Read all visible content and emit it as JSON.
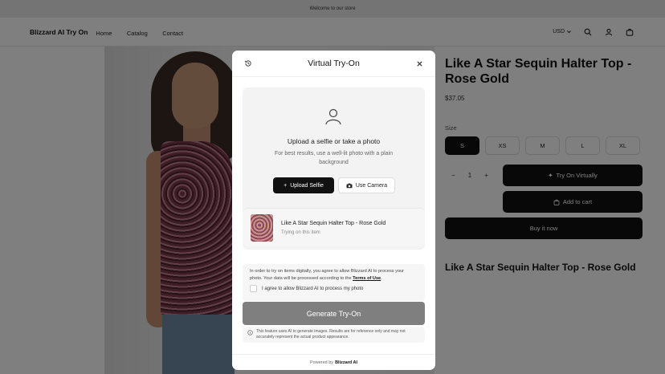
{
  "announcement": "Welcome to our store",
  "header": {
    "brand": "Blizzard AI Try On",
    "nav": [
      "Home",
      "Catalog",
      "Contact"
    ],
    "currency": "USD"
  },
  "product": {
    "title": "Like A Star Sequin Halter Top - Rose Gold",
    "price": "$37.05",
    "size_label": "Size",
    "sizes": [
      "S",
      "XS",
      "M",
      "L",
      "XL"
    ],
    "selected_size": "S",
    "quantity": "1",
    "try_on_label": "Try On Virtually",
    "add_to_cart_label": "Add to cart",
    "buy_now_label": "Buy it now"
  },
  "modal": {
    "title": "Virtual Try-On",
    "upload_title": "Upload a selfie or take a photo",
    "upload_sub": "For best results, use a well-lit photo with a plain background",
    "upload_button": "Upload Selfie",
    "camera_button": "Use Camera",
    "product_title": "Like A Star Sequin Halter Top - Rose Gold",
    "product_sub": "Trying on this item",
    "consent_text": "In order to try on items digitally, you agree to allow Blizzard AI to process your photo. Your data will be processed according to the",
    "terms_link": "Terms of Use",
    "consent_period": ".",
    "checkbox_label": "I agree to allow Blizzard AI to process my photo",
    "generate_button": "Generate Try-On",
    "note": "This feature uses AI to generate images. Results are for reference only and may not accurately represent the actual product appearance.",
    "powered_prefix": "Powered by",
    "powered_brand": "Blizzard AI"
  },
  "icons": {
    "history": "history-icon",
    "close": "close-icon",
    "search": "search-icon",
    "account": "user-icon",
    "cart": "cart-icon"
  }
}
